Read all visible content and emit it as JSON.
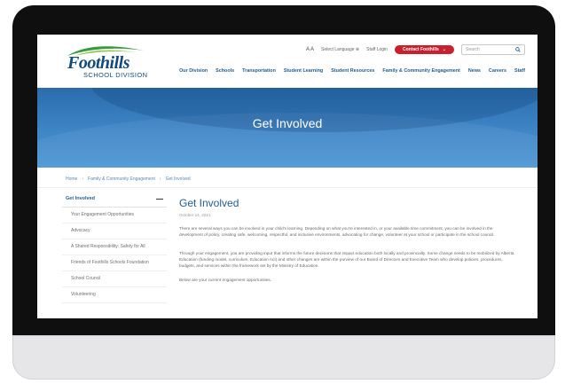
{
  "site": {
    "logo_word": "Foothills",
    "logo_sub": "SCHOOL DIVISION"
  },
  "topbar": {
    "text_size": "A A",
    "language": "Select Language",
    "login": "Staff Login",
    "contact": "Contact Foothills",
    "search_placeholder": "Search"
  },
  "nav": [
    "Our Division",
    "Schools",
    "Transportation",
    "Student Learning",
    "Student Resources",
    "Family & Community Engagement",
    "News",
    "Careers",
    "Staff"
  ],
  "banner": {
    "title": "Get Involved"
  },
  "breadcrumb": [
    "Home",
    "Family & Community Engagement",
    "Get Involved"
  ],
  "sidebar": {
    "heading": "Get Involved",
    "items": [
      "Your Engagement Opportunities",
      "Advocacy",
      "A Shared Responsibility: Safety for All",
      "Friends of Foothills Schools Foundation",
      "School Council",
      "Volunteering"
    ]
  },
  "content": {
    "title": "Get Involved",
    "date": "October 14, 2021",
    "p1": "There are several ways you can be involved in your child's learning. Depending on what you're interested in, or your available time commitment, you can be involved in the development of policy, creating safe, welcoming, respectful, and inclusive environments, advocating for change, volunteer at your school or participate in the school council.",
    "p2": "Through your engagement, you are providing input that informs the future decisions that impact education both locally and provincially. Some change needs to be mobilized by Alberta Education (funding model, curriculum, Education Act) and other changes are within the purview of our Board of Directors and Executive Team who develop policies, procedures, budgets, and services within the framework set by the Ministry of Education.",
    "p3": "Below are your current engagement opportunities."
  },
  "colors": {
    "brand_blue": "#1f5d91",
    "banner_blue": "#3f86c7",
    "contact_red": "#c8202f",
    "logo_green": "#3a9a3f"
  }
}
